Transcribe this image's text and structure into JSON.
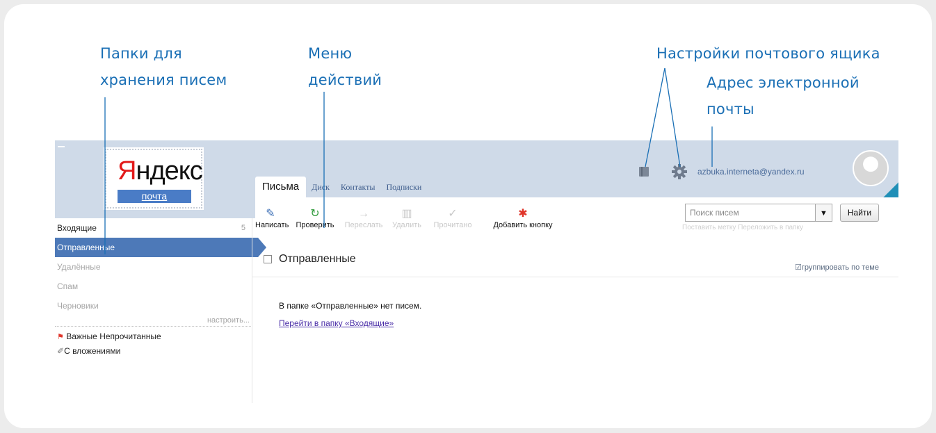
{
  "annotations": {
    "folders": "Папки для\nхранения писем",
    "folders_l1": "Папки для",
    "folders_l2": "хранения писем",
    "menu_l1": "Меню",
    "menu_l2": "действий",
    "settings": "Настройки почтового ящика",
    "address_l1": "Адрес электронной",
    "address_l2": "почты"
  },
  "logo": {
    "word_ya": "Я",
    "word_rest": "ндекс",
    "sub": "почта"
  },
  "tabs": [
    {
      "label": "Письма",
      "active": true
    },
    {
      "label": "Диск"
    },
    {
      "label": "Контакты"
    },
    {
      "label": "Подписки"
    }
  ],
  "header": {
    "email": "azbuka.interneta@yandex.ru"
  },
  "toolbar": {
    "compose": "Написать",
    "check": "Проверить",
    "forward": "Переслать",
    "delete": "Удалить",
    "mark": "Прочитано",
    "add_button": "Добавить кнопку"
  },
  "search": {
    "placeholder": "Поиск писем",
    "dropdown": "▼",
    "find": "Найти",
    "sublinks": "Поставить метку   Переложить в папку"
  },
  "sidebar": {
    "folders": [
      {
        "label": "Входящие",
        "count": "5"
      },
      {
        "label": "Отправленные"
      },
      {
        "label": "Удалённые"
      },
      {
        "label": "Спам"
      },
      {
        "label": "Черновики"
      }
    ],
    "configure": "настроить...",
    "important": "Важные",
    "unread": "Непрочитанные",
    "attachments": "С вложениями"
  },
  "main": {
    "folder_title": "Отправленные",
    "group_label": "группировать по теме",
    "empty_text": "В папке «Отправленные» нет писем.",
    "inbox_link": "Перейти в папку «Входящие»"
  },
  "colors": {
    "annotation": "#1a6fb5",
    "topbar": "#cfdae8",
    "active_folder": "#4d79b8"
  }
}
